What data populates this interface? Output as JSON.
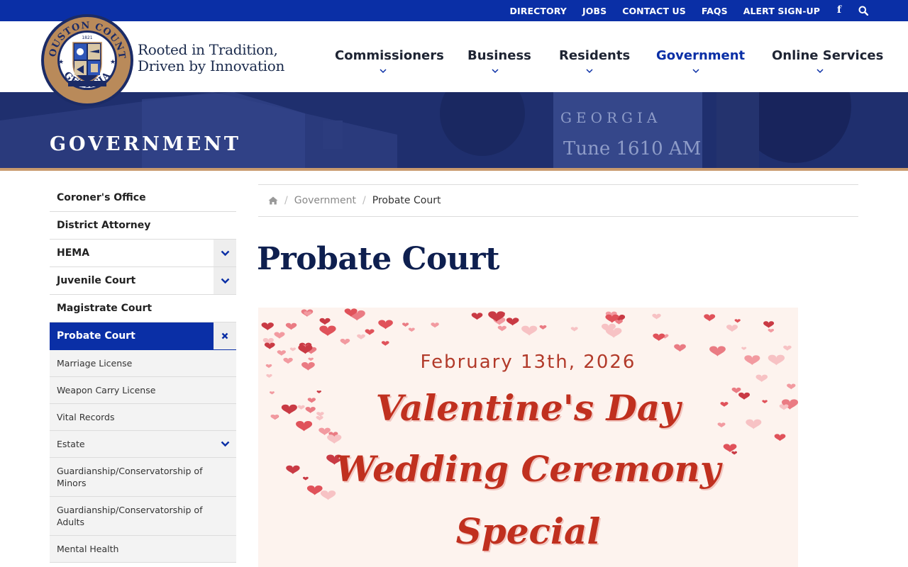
{
  "topbar": {
    "links": [
      "DIRECTORY",
      "JOBS",
      "CONTACT US",
      "FAQS",
      "ALERT SIGN-UP"
    ],
    "facebook_icon": "facebook-icon",
    "search_icon": "search-icon"
  },
  "header": {
    "seal": {
      "top_text": "HOUSTON COUNTY",
      "bottom_text": "GEORGIA",
      "year": "1821"
    },
    "tagline_line1": "Rooted in Tradition,",
    "tagline_line2": "Driven by Innovation",
    "nav": [
      {
        "label": "Commissioners",
        "active": false
      },
      {
        "label": "Business",
        "active": false
      },
      {
        "label": "Residents",
        "active": false
      },
      {
        "label": "Government",
        "active": true
      },
      {
        "label": "Online Services",
        "active": false
      }
    ]
  },
  "hero": {
    "title": "GOVERNMENT",
    "sign_line1": "GEORGIA",
    "sign_line2": "Tune 1610 AM"
  },
  "sidebar": {
    "items": [
      {
        "label": "Coroner's Office",
        "toggle": ""
      },
      {
        "label": "District Attorney",
        "toggle": ""
      },
      {
        "label": "HEMA",
        "toggle": "chevron-down"
      },
      {
        "label": "Juvenile Court",
        "toggle": "chevron-down"
      },
      {
        "label": "Magistrate Court",
        "toggle": ""
      },
      {
        "label": "Probate Court",
        "toggle": "close",
        "active": true
      }
    ],
    "subitems": [
      {
        "label": "Marriage License",
        "toggle": ""
      },
      {
        "label": "Weapon Carry License",
        "toggle": ""
      },
      {
        "label": "Vital Records",
        "toggle": ""
      },
      {
        "label": "Estate",
        "toggle": "chevron-down"
      },
      {
        "label": "Guardianship/Conservatorship of Minors",
        "toggle": ""
      },
      {
        "label": "Guardianship/Conservatorship of Adults",
        "toggle": ""
      },
      {
        "label": "Mental Health",
        "toggle": ""
      }
    ]
  },
  "breadcrumb": {
    "home_icon": "home-icon",
    "parent": "Government",
    "current": "Probate Court"
  },
  "main": {
    "title": "Probate Court",
    "flyer": {
      "date": "February 13th, 2026",
      "line1": "Valentine's Day",
      "line2": "Wedding Ceremony",
      "line3": "Special"
    }
  },
  "colors": {
    "brand_blue": "#0a2fa6",
    "navy": "#0e1f4f",
    "accent_tan": "#c99a6e",
    "heart_red": "#c0301f"
  }
}
